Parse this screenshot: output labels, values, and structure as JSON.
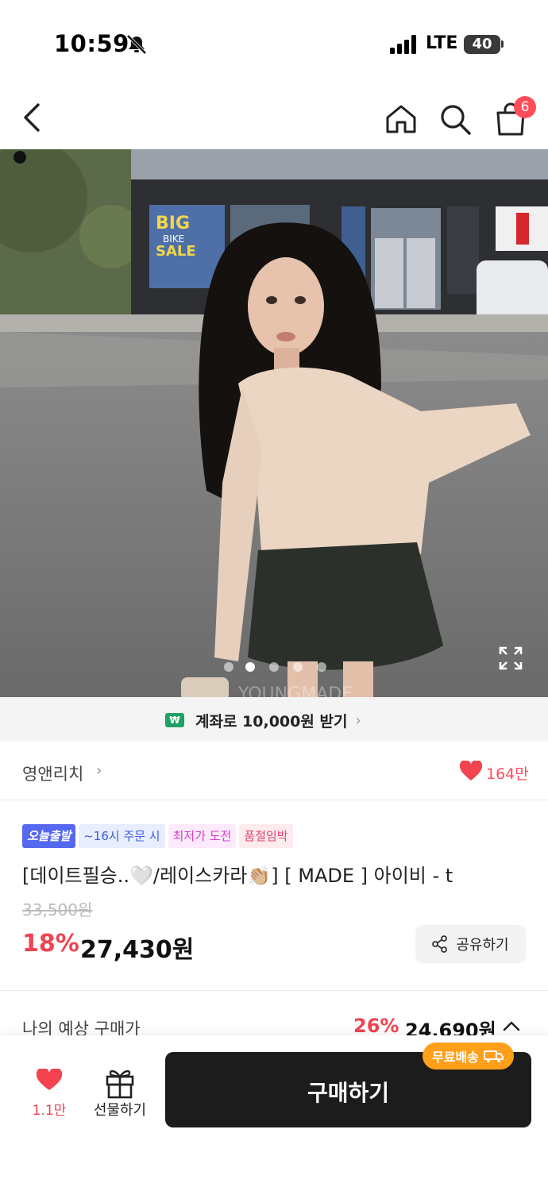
{
  "status_bar": {
    "time": "10:59",
    "network": "LTE",
    "battery": "40"
  },
  "header": {
    "cart_count": "6"
  },
  "gallery": {
    "page_count": 5,
    "active_index": 1
  },
  "promo": {
    "text": "계좌로 10,000원 받기"
  },
  "brand": {
    "name": "영앤리치",
    "likes": "164만"
  },
  "product": {
    "tags": [
      "오늘출발",
      "~16시 주문 시",
      "최저가 도전",
      "품절임박"
    ],
    "title": "[데이트필승..🤍/레이스카라👏🏼] [ MADE ] 아이비 - t",
    "original_price": "33,500원",
    "discount": "18%",
    "sale_price": "27,430원",
    "share_label": "공유하기"
  },
  "expected": {
    "label": "나의 예상 구매가",
    "discount": "26%",
    "price": "24,690원"
  },
  "bottom": {
    "wish_count": "1.1만",
    "gift_label": "선물하기",
    "buy_label": "구매하기",
    "free_shipping": "무료배송"
  },
  "colors": {
    "accent_red": "#ef4452",
    "buy_button": "#1c1c1c",
    "free_shipping": "#ff9f1a"
  }
}
